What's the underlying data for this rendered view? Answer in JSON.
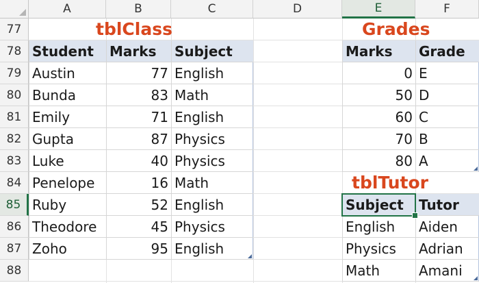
{
  "columns": [
    "A",
    "B",
    "C",
    "D",
    "E",
    "F"
  ],
  "selected_column": "E",
  "rows": [
    "77",
    "78",
    "79",
    "80",
    "81",
    "82",
    "83",
    "84",
    "85",
    "86",
    "87",
    "88"
  ],
  "selected_row": "85",
  "tblClass": {
    "title": "tblClass",
    "headers": [
      "Student",
      "Marks",
      "Subject"
    ],
    "rows": [
      [
        "Austin",
        "77",
        "English"
      ],
      [
        "Bunda",
        "83",
        "Math"
      ],
      [
        "Emily",
        "71",
        "English"
      ],
      [
        "Gupta",
        "87",
        "Physics"
      ],
      [
        "Luke",
        "40",
        "Physics"
      ],
      [
        "Penelope",
        "16",
        "Math"
      ],
      [
        "Ruby",
        "52",
        "English"
      ],
      [
        "Theodore",
        "45",
        "Physics"
      ],
      [
        "Zoho",
        "95",
        "English"
      ]
    ]
  },
  "grades": {
    "title": "Grades",
    "headers": [
      "Marks",
      "Grade"
    ],
    "rows": [
      [
        "0",
        "E"
      ],
      [
        "50",
        "D"
      ],
      [
        "60",
        "C"
      ],
      [
        "70",
        "B"
      ],
      [
        "80",
        "A"
      ]
    ]
  },
  "tblTutor": {
    "title": "tblTutor",
    "headers": [
      "Subject",
      "Tutor"
    ],
    "rows": [
      [
        "English",
        "Aiden"
      ],
      [
        "Physics",
        "Adrian"
      ],
      [
        "Math",
        "Amani"
      ]
    ]
  },
  "colors": {
    "title": "#d9471e",
    "table_header": "#dde4ef",
    "selection": "#217346"
  }
}
